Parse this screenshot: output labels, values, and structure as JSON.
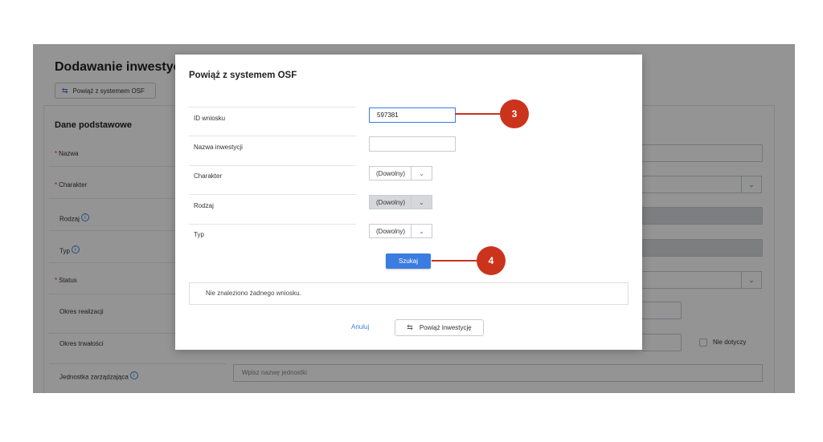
{
  "background": {
    "page_title": "Dodawanie inwestycji",
    "osf_button_label": "Powiąż z systemem OSF",
    "section_title": "Dane podstawowe",
    "required_mark": "*",
    "info_glyph": "i",
    "labels": {
      "nazwa": "Nazwa",
      "charakter": "Charakter",
      "rodzaj": "Rodzaj",
      "typ": "Typ",
      "status": "Status",
      "okres_realizacji": "Okres realizacji",
      "okres_trwalosci": "Okres trwałości",
      "jednostka": "Jednostka zarządzająca"
    },
    "nie_dotyczy": "Nie dotyczy",
    "unit_placeholder": "Wpisz nazwę jednostki"
  },
  "modal": {
    "title": "Powiąż z systemem OSF",
    "fields": {
      "id_label": "ID wniosku",
      "id_value": "597381",
      "nazwa_label": "Nazwa inwestycji",
      "nazwa_value": "",
      "charakter_label": "Charakter",
      "charakter_value": "(Dowolny)",
      "rodzaj_label": "Rodzaj",
      "rodzaj_value": "(Dowolny)",
      "typ_label": "Typ",
      "typ_value": "(Dowolny)"
    },
    "search_label": "Szukaj",
    "no_results": "Nie znaleziono żadnego wniosku.",
    "cancel_label": "Anuluj",
    "link_label": "Powiąż inwestycję"
  },
  "icons": {
    "link": "⇆",
    "chevron": "⌄"
  },
  "annotations": {
    "step_input": "3",
    "step_search": "4",
    "color": "#cc331d"
  },
  "colors": {
    "accent": "#3b7ce0",
    "overlay": "rgba(0,0,0,0.42)"
  }
}
